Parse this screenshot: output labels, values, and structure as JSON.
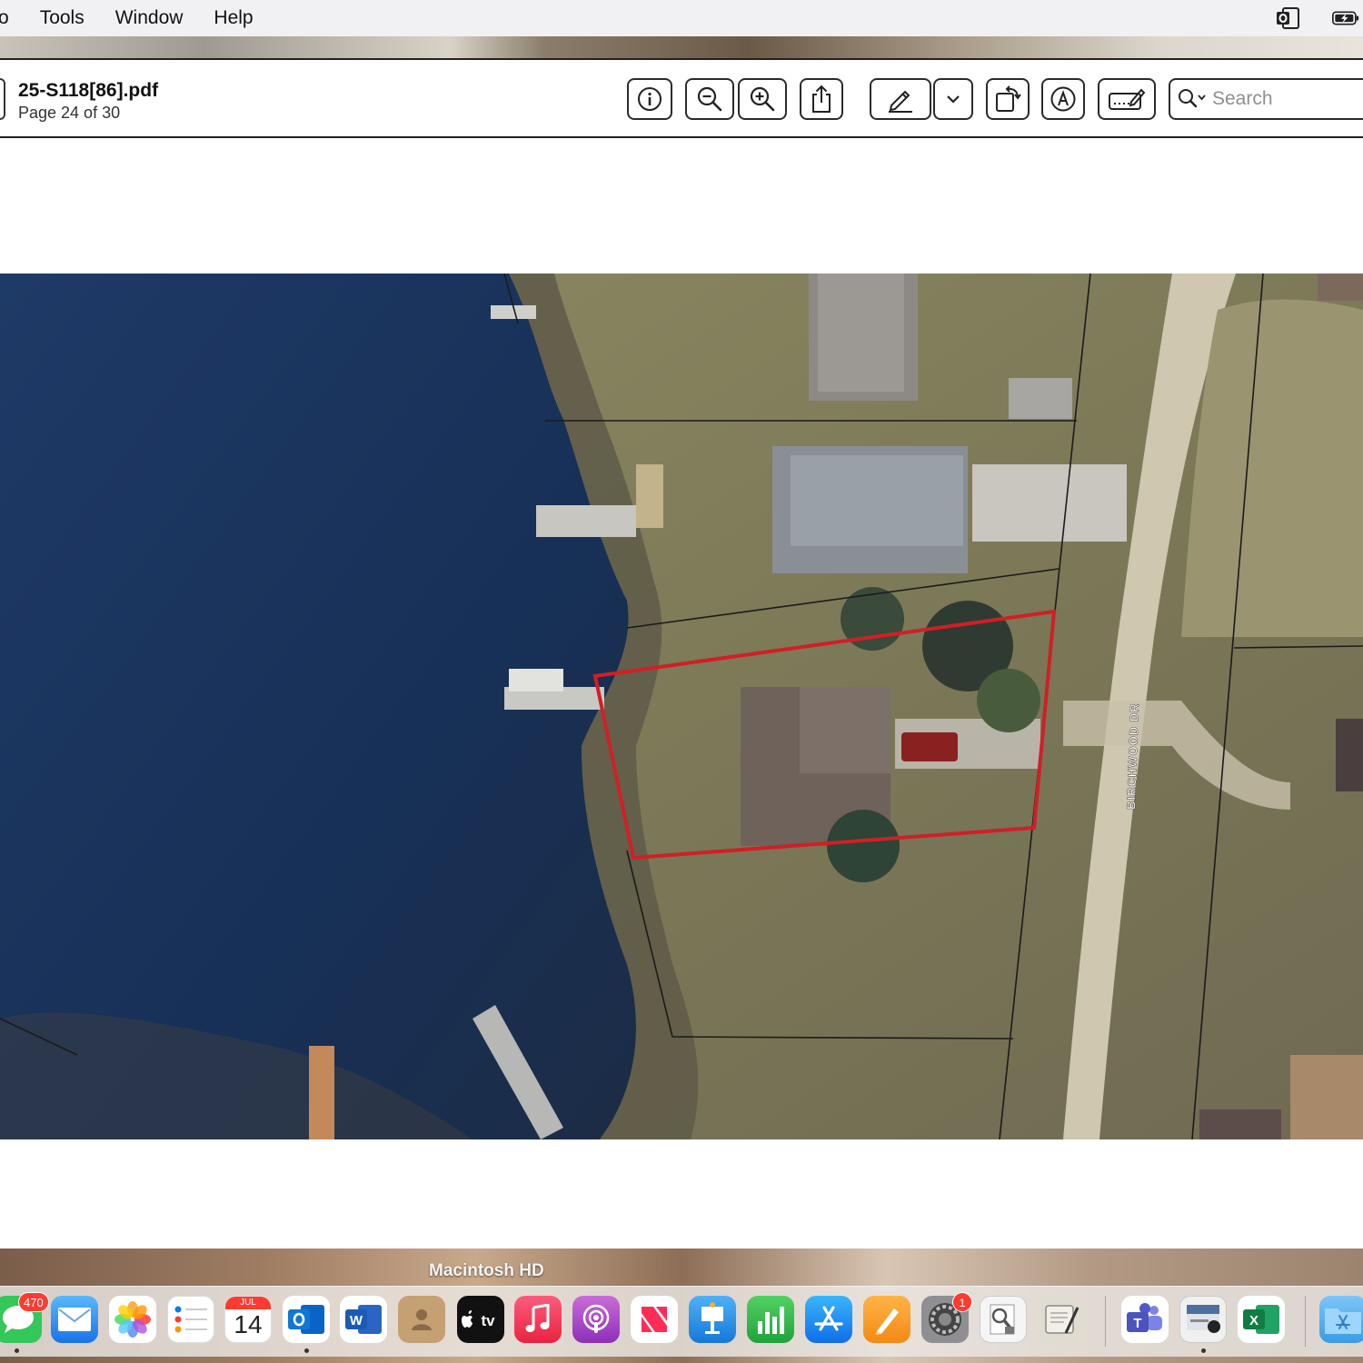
{
  "menubar": {
    "items": [
      "o",
      "Tools",
      "Window",
      "Help"
    ],
    "right_icons": [
      "outlook-status-icon",
      "battery-icon"
    ]
  },
  "toolbar": {
    "title": "25-S118[86].pdf",
    "page_info": "Page 24 of 30",
    "buttons": [
      "info-icon",
      "zoom-out-icon",
      "zoom-in-icon",
      "share-icon",
      "markup-pen-icon",
      "chevron-down-icon",
      "rotate-icon",
      "annotate-icon",
      "form-fill-icon"
    ],
    "search_placeholder": "Search"
  },
  "map": {
    "road_label": "BIRCHWOOD DR",
    "highlight_color": "#d11f26"
  },
  "dock": {
    "volume_label": "Macintosh HD",
    "messages_badge": "470",
    "calendar_month": "JUL",
    "calendar_day": "14",
    "settings_badge": "1",
    "apps": [
      "Messages",
      "Mail",
      "Photos",
      "Reminders",
      "Calendar",
      "Outlook",
      "Word",
      "Contacts",
      "TV",
      "Music",
      "Podcasts",
      "News",
      "Keynote",
      "Numbers",
      "App Store",
      "Pages",
      "System Preferences",
      "Preview",
      "Script Editor",
      "Teams",
      "Preview Document",
      "Excel",
      "Finder"
    ]
  }
}
